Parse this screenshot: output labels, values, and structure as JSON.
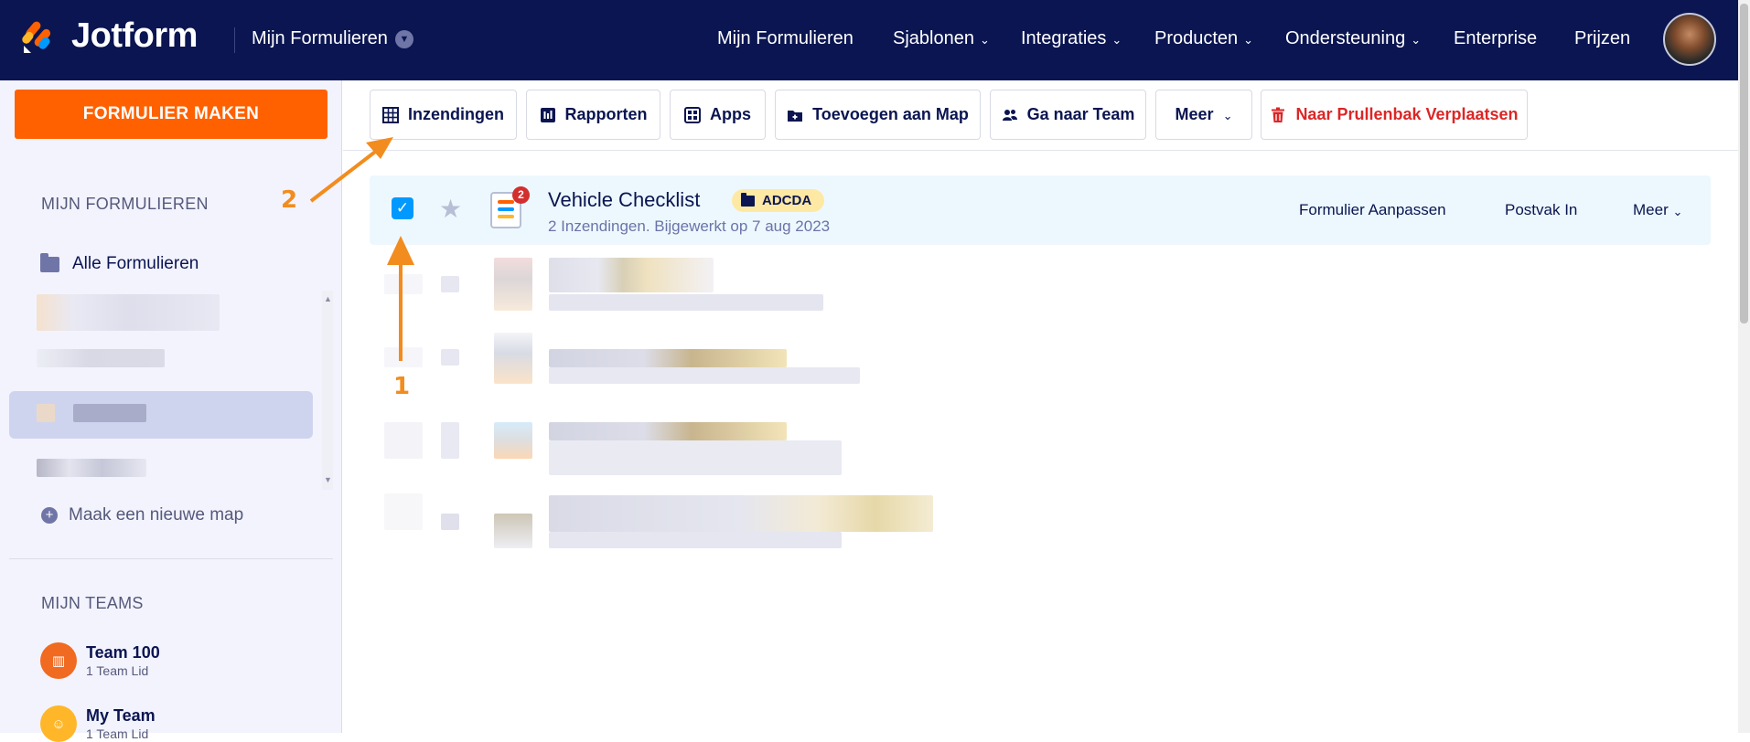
{
  "header": {
    "brand": "Jotform",
    "workspace_dropdown": "Mijn Formulieren",
    "nav": [
      {
        "label": "Mijn Formulieren",
        "has_dropdown": false
      },
      {
        "label": "Sjablonen",
        "has_dropdown": true
      },
      {
        "label": "Integraties",
        "has_dropdown": true
      },
      {
        "label": "Producten",
        "has_dropdown": true
      },
      {
        "label": "Ondersteuning",
        "has_dropdown": true
      },
      {
        "label": "Enterprise",
        "has_dropdown": false
      },
      {
        "label": "Prijzen",
        "has_dropdown": false
      }
    ]
  },
  "sidebar": {
    "create_button": "FORMULIER MAKEN",
    "forms_section_title": "MIJN FORMULIEREN",
    "all_forms": "Alle Formulieren",
    "new_folder": "Maak een nieuwe map",
    "teams_section_title": "MIJN TEAMS",
    "teams": [
      {
        "name": "Team 100",
        "members": "1 Team Lid"
      },
      {
        "name": "My Team",
        "members": "1 Team Lid"
      }
    ]
  },
  "toolbar": {
    "submissions": "Inzendingen",
    "reports": "Rapporten",
    "apps": "Apps",
    "add_to_folder": "Toevoegen aan Map",
    "go_to_team": "Ga naar Team",
    "more": "Meer",
    "move_to_trash": "Naar Prullenbak Verplaatsen"
  },
  "form_row": {
    "title": "Vehicle Checklist",
    "tag": "ADCDA",
    "badge_count": "2",
    "subtitle": "2 Inzendingen. Bijgewerkt op 7 aug 2023",
    "actions": {
      "edit": "Formulier Aanpassen",
      "inbox": "Postvak In",
      "more": "Meer"
    }
  },
  "annotations": {
    "step_1": "1",
    "step_2": "2"
  },
  "colors": {
    "header_bg": "#0a1551",
    "create_button": "#ff6100",
    "selected_row_bg": "#edf8fe",
    "checkbox": "#0099ff",
    "danger": "#dc2626",
    "annotation_arrow": "#f28c1e",
    "tag_bg": "#fde9a3"
  }
}
